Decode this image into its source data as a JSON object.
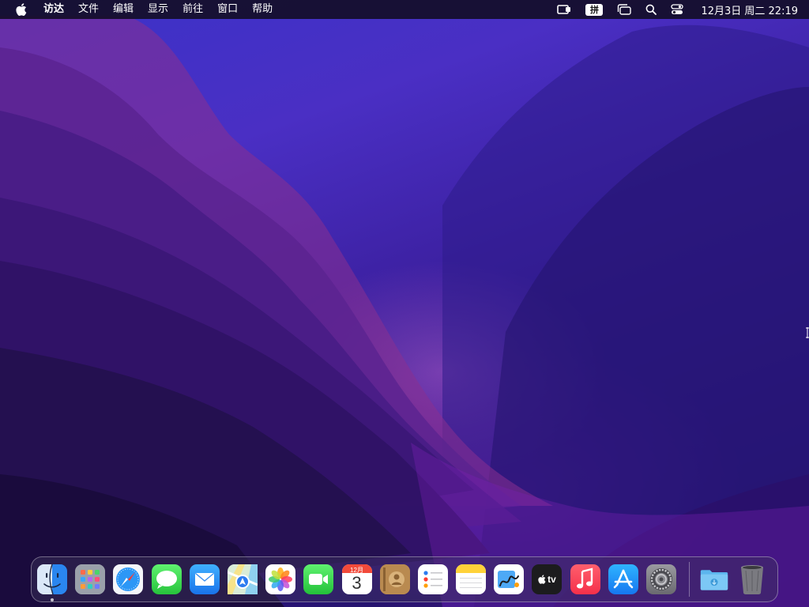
{
  "menubar": {
    "app_name": "访达",
    "menus": [
      "文件",
      "编辑",
      "显示",
      "前往",
      "窗口",
      "帮助"
    ],
    "ime_label": "拼",
    "clock": "12月3日 周二  22:19",
    "status_icons": [
      "screen-mirroring-icon",
      "input-method-icon",
      "stage-manager-icon",
      "search-icon",
      "control-center-icon"
    ]
  },
  "dock": {
    "apps": [
      {
        "name": "Finder",
        "icon": "finder-icon",
        "running": true
      },
      {
        "name": "Launchpad",
        "icon": "launchpad-icon"
      },
      {
        "name": "Safari",
        "icon": "safari-icon"
      },
      {
        "name": "Messages",
        "icon": "messages-icon"
      },
      {
        "name": "Mail",
        "icon": "mail-icon"
      },
      {
        "name": "Maps",
        "icon": "maps-icon"
      },
      {
        "name": "Photos",
        "icon": "photos-icon"
      },
      {
        "name": "FaceTime",
        "icon": "facetime-icon"
      },
      {
        "name": "Calendar",
        "icon": "calendar-icon"
      },
      {
        "name": "Contacts",
        "icon": "contacts-icon"
      },
      {
        "name": "Reminders",
        "icon": "reminders-icon"
      },
      {
        "name": "Notes",
        "icon": "notes-icon"
      },
      {
        "name": "Freeform",
        "icon": "freeform-icon"
      },
      {
        "name": "TV",
        "icon": "apple-tv-icon"
      },
      {
        "name": "Music",
        "icon": "music-icon"
      },
      {
        "name": "App Store",
        "icon": "app-store-icon"
      },
      {
        "name": "System Settings",
        "icon": "system-settings-icon"
      }
    ],
    "extras": [
      {
        "name": "Downloads",
        "icon": "downloads-folder-icon"
      },
      {
        "name": "Trash",
        "icon": "trash-icon"
      }
    ],
    "calendar_month": "12月",
    "calendar_day": "3",
    "tv_label": "tv"
  },
  "colors": {
    "wallpaper_top": "#3a32c8",
    "wallpaper_bottom": "#1d0f55",
    "menubar_bg": "#140e28"
  }
}
